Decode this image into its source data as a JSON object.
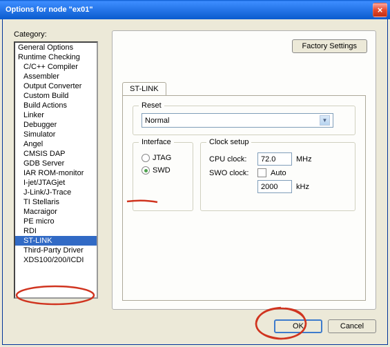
{
  "title": "Options for node \"ex01\"",
  "category_label": "Category:",
  "categories": [
    {
      "label": "General Options",
      "indent": false
    },
    {
      "label": "Runtime Checking",
      "indent": false
    },
    {
      "label": "C/C++ Compiler",
      "indent": true
    },
    {
      "label": "Assembler",
      "indent": true
    },
    {
      "label": "Output Converter",
      "indent": true
    },
    {
      "label": "Custom Build",
      "indent": true
    },
    {
      "label": "Build Actions",
      "indent": true
    },
    {
      "label": "Linker",
      "indent": true
    },
    {
      "label": "Debugger",
      "indent": true
    },
    {
      "label": "Simulator",
      "indent": true
    },
    {
      "label": "Angel",
      "indent": true
    },
    {
      "label": "CMSIS DAP",
      "indent": true
    },
    {
      "label": "GDB Server",
      "indent": true
    },
    {
      "label": "IAR ROM-monitor",
      "indent": true
    },
    {
      "label": "I-jet/JTAGjet",
      "indent": true
    },
    {
      "label": "J-Link/J-Trace",
      "indent": true
    },
    {
      "label": "TI Stellaris",
      "indent": true
    },
    {
      "label": "Macraigor",
      "indent": true
    },
    {
      "label": "PE micro",
      "indent": true
    },
    {
      "label": "RDI",
      "indent": true
    },
    {
      "label": "ST-LINK",
      "indent": true,
      "selected": true
    },
    {
      "label": "Third-Party Driver",
      "indent": true
    },
    {
      "label": "XDS100/200/ICDI",
      "indent": true
    }
  ],
  "factory_settings": "Factory Settings",
  "tab_label": "ST-LINK",
  "reset": {
    "legend": "Reset",
    "value": "Normal"
  },
  "interface": {
    "legend": "Interface",
    "jtag": "JTAG",
    "swd": "SWD",
    "selected": "SWD"
  },
  "clock": {
    "legend": "Clock setup",
    "cpu_label": "CPU clock:",
    "cpu_value": "72.0",
    "cpu_unit": "MHz",
    "swo_label": "SWO clock:",
    "auto_label": "Auto",
    "swo_value": "2000",
    "swo_unit": "kHz"
  },
  "ok": "OK",
  "cancel": "Cancel"
}
